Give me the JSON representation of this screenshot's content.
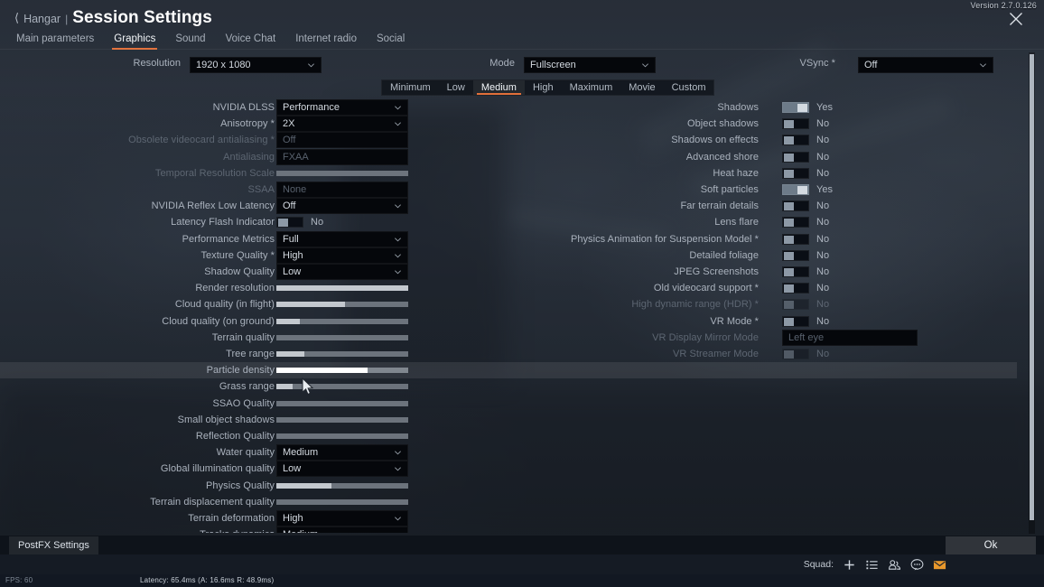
{
  "window": {
    "version": "Version 2.7.0.126",
    "close_icon": "close-icon"
  },
  "header": {
    "back_icon": "chevron-left-icon",
    "parent": "Hangar",
    "separator": "|",
    "title": "Session Settings"
  },
  "tabs": [
    {
      "label": "Main parameters",
      "active": false
    },
    {
      "label": "Graphics",
      "active": true
    },
    {
      "label": "Sound",
      "active": false
    },
    {
      "label": "Voice Chat",
      "active": false
    },
    {
      "label": "Internet radio",
      "active": false
    },
    {
      "label": "Social",
      "active": false
    }
  ],
  "toprow": {
    "resolution_label": "Resolution",
    "resolution_value": "1920 x 1080",
    "mode_label": "Mode",
    "mode_value": "Fullscreen",
    "vsync_label": "VSync *",
    "vsync_value": "Off"
  },
  "presets": [
    {
      "label": "Minimum",
      "active": false
    },
    {
      "label": "Low",
      "active": false
    },
    {
      "label": "Medium",
      "active": true
    },
    {
      "label": "High",
      "active": false
    },
    {
      "label": "Maximum",
      "active": false
    },
    {
      "label": "Movie",
      "active": false
    },
    {
      "label": "Custom",
      "active": false
    }
  ],
  "left_settings": [
    {
      "label": "NVIDIA DLSS",
      "type": "select",
      "value": "Performance",
      "disabled": false,
      "hover": false
    },
    {
      "label": "Anisotropy *",
      "type": "select",
      "value": "2X",
      "disabled": false,
      "hover": false
    },
    {
      "label": "Obsolete videocard antialiasing *",
      "type": "select",
      "value": "Off",
      "disabled": true,
      "hover": false
    },
    {
      "label": "Antialiasing",
      "type": "select",
      "value": "FXAA",
      "disabled": true,
      "hover": false
    },
    {
      "label": "Temporal Resolution Scale",
      "type": "slider",
      "value": 0,
      "disabled": true,
      "hover": false
    },
    {
      "label": "SSAA",
      "type": "select",
      "value": "None",
      "disabled": true,
      "hover": false
    },
    {
      "label": "NVIDIA Reflex Low Latency",
      "type": "select",
      "value": "Off",
      "disabled": false,
      "hover": false
    },
    {
      "label": "Latency Flash Indicator",
      "type": "toggle",
      "value": "No",
      "on": false,
      "disabled": false,
      "hover": false
    },
    {
      "label": "Performance Metrics",
      "type": "select",
      "value": "Full",
      "disabled": false,
      "hover": false
    },
    {
      "label": "Texture Quality *",
      "type": "select",
      "value": "High",
      "disabled": false,
      "hover": false
    },
    {
      "label": "Shadow Quality",
      "type": "select",
      "value": "Low",
      "disabled": false,
      "hover": false
    },
    {
      "label": "Render resolution",
      "type": "slider",
      "value": 100,
      "disabled": false,
      "hover": false
    },
    {
      "label": "Cloud quality (in flight)",
      "type": "slider",
      "value": 52,
      "disabled": false,
      "hover": false
    },
    {
      "label": "Cloud quality (on ground)",
      "type": "slider",
      "value": 18,
      "disabled": false,
      "hover": false
    },
    {
      "label": "Terrain quality",
      "type": "slider",
      "value": 0,
      "disabled": false,
      "hover": false
    },
    {
      "label": "Tree range",
      "type": "slider",
      "value": 21,
      "disabled": false,
      "hover": false
    },
    {
      "label": "Particle density",
      "type": "slider",
      "value": 69,
      "disabled": false,
      "hover": true
    },
    {
      "label": "Grass range",
      "type": "slider",
      "value": 12,
      "disabled": false,
      "hover": false
    },
    {
      "label": "SSAO Quality",
      "type": "slider",
      "value": 0,
      "disabled": false,
      "hover": false
    },
    {
      "label": "Small object shadows",
      "type": "slider",
      "value": 0,
      "disabled": false,
      "hover": false
    },
    {
      "label": "Reflection Quality",
      "type": "slider",
      "value": 0,
      "disabled": false,
      "hover": false
    },
    {
      "label": "Water quality",
      "type": "select",
      "value": "Medium",
      "disabled": false,
      "hover": false
    },
    {
      "label": "Global illumination quality",
      "type": "select",
      "value": "Low",
      "disabled": false,
      "hover": false
    },
    {
      "label": "Physics Quality",
      "type": "slider",
      "value": 42,
      "disabled": false,
      "hover": false
    },
    {
      "label": "Terrain displacement quality",
      "type": "slider",
      "value": 0,
      "disabled": false,
      "hover": false
    },
    {
      "label": "Terrain deformation",
      "type": "select",
      "value": "High",
      "disabled": false,
      "hover": false
    },
    {
      "label": "Tracks dynamics",
      "type": "select",
      "value": "Medium",
      "disabled": false,
      "hover": false
    }
  ],
  "right_settings": [
    {
      "label": "Shadows",
      "type": "toggle",
      "value": "Yes",
      "on": true,
      "disabled": false
    },
    {
      "label": "Object shadows",
      "type": "toggle",
      "value": "No",
      "on": false,
      "disabled": false
    },
    {
      "label": "Shadows on effects",
      "type": "toggle",
      "value": "No",
      "on": false,
      "disabled": false
    },
    {
      "label": "Advanced shore",
      "type": "toggle",
      "value": "No",
      "on": false,
      "disabled": false
    },
    {
      "label": "Heat haze",
      "type": "toggle",
      "value": "No",
      "on": false,
      "disabled": false
    },
    {
      "label": "Soft particles",
      "type": "toggle",
      "value": "Yes",
      "on": true,
      "disabled": false
    },
    {
      "label": "Far terrain details",
      "type": "toggle",
      "value": "No",
      "on": false,
      "disabled": false
    },
    {
      "label": "Lens flare",
      "type": "toggle",
      "value": "No",
      "on": false,
      "disabled": false
    },
    {
      "label": "Physics Animation for Suspension Model *",
      "type": "toggle",
      "value": "No",
      "on": false,
      "disabled": false
    },
    {
      "label": "Detailed foliage",
      "type": "toggle",
      "value": "No",
      "on": false,
      "disabled": false
    },
    {
      "label": "JPEG Screenshots",
      "type": "toggle",
      "value": "No",
      "on": false,
      "disabled": false
    },
    {
      "label": "Old videocard support *",
      "type": "toggle",
      "value": "No",
      "on": false,
      "disabled": false
    },
    {
      "label": "High dynamic range (HDR) *",
      "type": "toggle",
      "value": "No",
      "on": false,
      "disabled": true
    },
    {
      "label": "VR Mode *",
      "type": "toggle",
      "value": "No",
      "on": false,
      "disabled": false
    },
    {
      "label": "VR Display Mirror Mode",
      "type": "select",
      "value": "Left eye",
      "disabled": true,
      "wide": true
    },
    {
      "label": "VR Streamer Mode",
      "type": "toggle",
      "value": "No",
      "on": false,
      "disabled": true
    }
  ],
  "bottom": {
    "postfx_label": "PostFX Settings",
    "ok_label": "Ok"
  },
  "squad": {
    "label": "Squad:",
    "icons": [
      {
        "name": "plus-icon"
      },
      {
        "name": "list-icon"
      },
      {
        "name": "players-icon"
      },
      {
        "name": "chat-icon"
      },
      {
        "name": "mail-icon"
      }
    ]
  },
  "status": {
    "fps": "FPS: 60",
    "latency": "Latency: 65.4ms (A: 16.6ms R: 48.9ms)"
  },
  "colors": {
    "accent": "#e2703a",
    "mail": "#e8982c",
    "panel": "#05070b"
  }
}
